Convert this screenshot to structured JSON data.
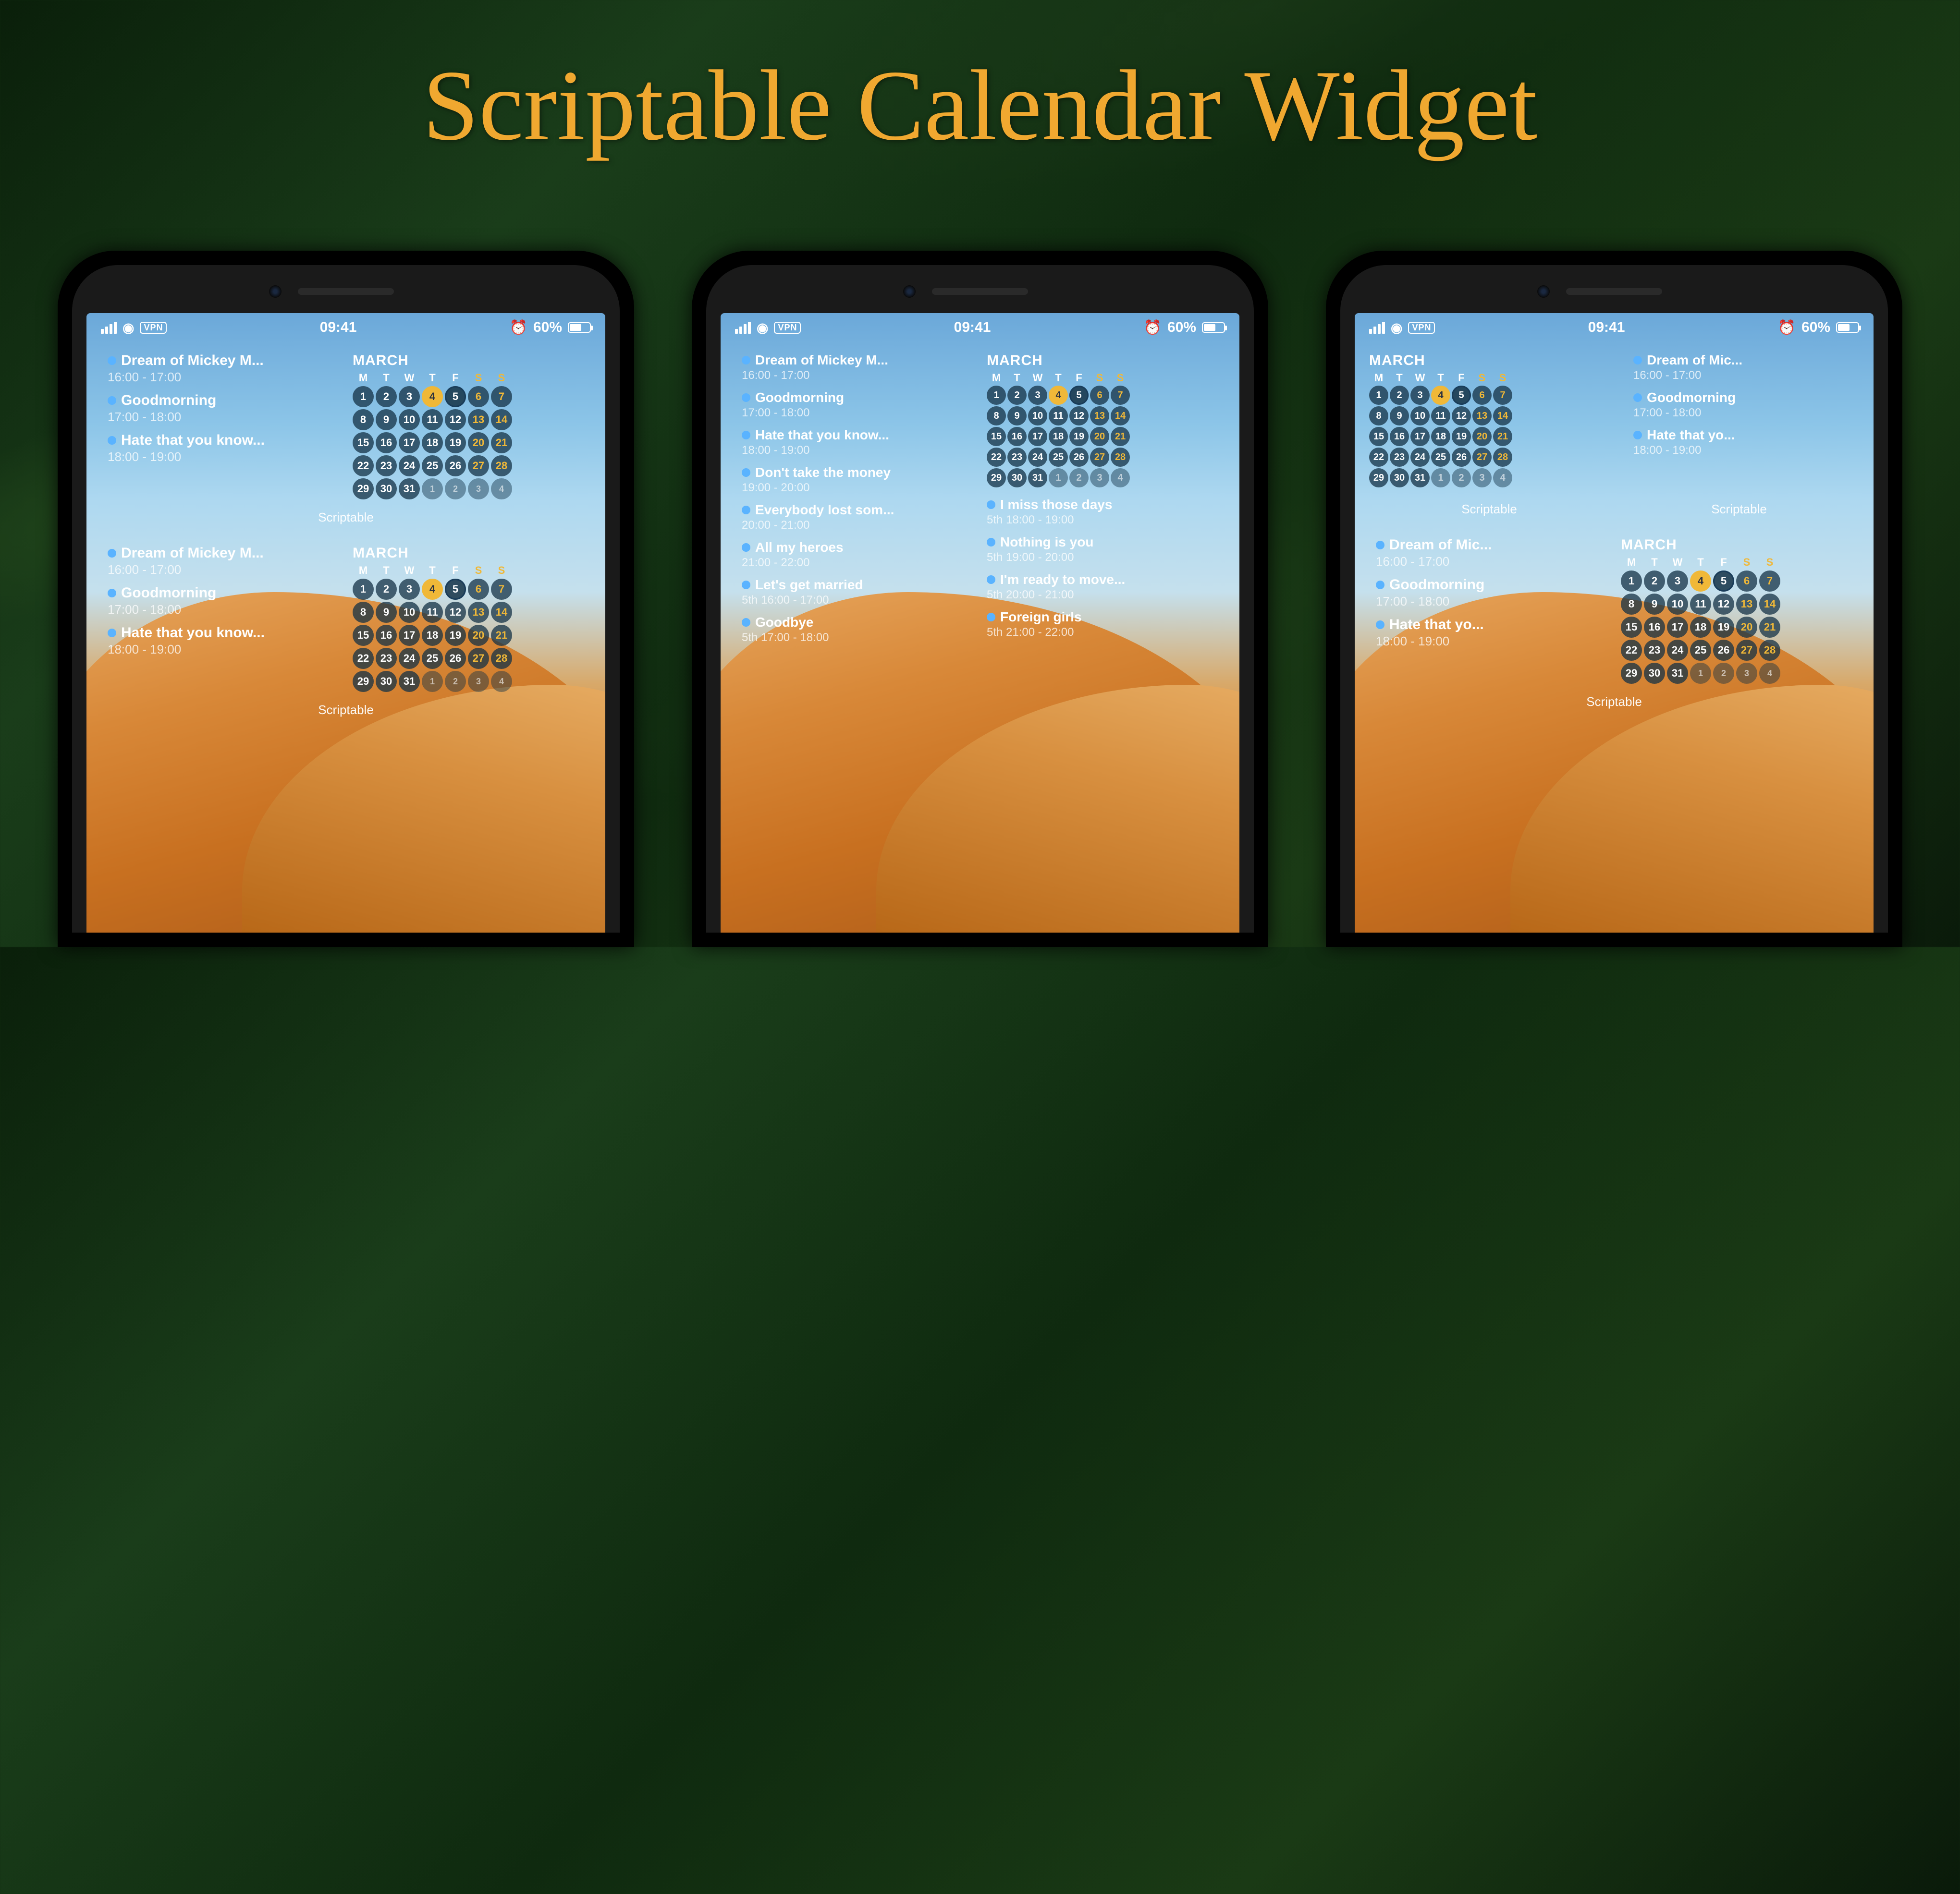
{
  "title": "Scriptable Calendar Widget",
  "status": {
    "time": "09:41",
    "vpn": "VPN",
    "battery": "60%"
  },
  "app_label": "Scriptable",
  "calendar": {
    "month": "MARCH",
    "weekdays": [
      "M",
      "T",
      "W",
      "T",
      "F",
      "S",
      "S"
    ],
    "today": 4,
    "weeks": [
      [
        {
          "d": 1
        },
        {
          "d": 2
        },
        {
          "d": 3
        },
        {
          "d": 4,
          "t": true
        },
        {
          "d": 5,
          "e": true
        },
        {
          "d": 6,
          "w": true
        },
        {
          "d": 7,
          "w": true
        }
      ],
      [
        {
          "d": 8
        },
        {
          "d": 9
        },
        {
          "d": 10
        },
        {
          "d": 11
        },
        {
          "d": 12
        },
        {
          "d": 13,
          "w": true
        },
        {
          "d": 14,
          "w": true
        }
      ],
      [
        {
          "d": 15
        },
        {
          "d": 16
        },
        {
          "d": 17
        },
        {
          "d": 18
        },
        {
          "d": 19
        },
        {
          "d": 20,
          "w": true
        },
        {
          "d": 21,
          "w": true
        }
      ],
      [
        {
          "d": 22
        },
        {
          "d": 23
        },
        {
          "d": 24
        },
        {
          "d": 25
        },
        {
          "d": 26
        },
        {
          "d": 27,
          "w": true
        },
        {
          "d": 28,
          "w": true
        }
      ],
      [
        {
          "d": 29
        },
        {
          "d": 30
        },
        {
          "d": 31
        },
        {
          "d": 1,
          "o": true
        },
        {
          "d": 2,
          "o": true
        },
        {
          "d": 3,
          "o": true,
          "w": true
        },
        {
          "d": 4,
          "o": true,
          "w": true
        }
      ]
    ]
  },
  "events_short": [
    {
      "title": "Dream of Mickey M...",
      "time": "16:00 - 17:00"
    },
    {
      "title": "Goodmorning",
      "time": "17:00 - 18:00"
    },
    {
      "title": "Hate that you know...",
      "time": "18:00 - 19:00"
    }
  ],
  "events_short_narrow": [
    {
      "title": "Dream of Mic...",
      "time": "16:00 - 17:00"
    },
    {
      "title": "Goodmorning",
      "time": "17:00 - 18:00"
    },
    {
      "title": "Hate that yo...",
      "time": "18:00 - 19:00"
    }
  ],
  "large_left_events": [
    {
      "title": "Dream of Mickey M...",
      "time": "16:00 - 17:00"
    },
    {
      "title": "Goodmorning",
      "time": "17:00 - 18:00"
    },
    {
      "title": "Hate that you know...",
      "time": "18:00 - 19:00"
    },
    {
      "title": "Don't take the money",
      "time": "19:00 - 20:00"
    },
    {
      "title": "Everybody lost som...",
      "time": "20:00 - 21:00"
    },
    {
      "title": "All my heroes",
      "time": "21:00 - 22:00"
    },
    {
      "title": "Let's get married",
      "time": "5th 16:00 - 17:00"
    },
    {
      "title": "Goodbye",
      "time": "5th 17:00 - 18:00"
    }
  ],
  "large_right_events": [
    {
      "title": "I miss those days",
      "time": "5th 18:00 - 19:00"
    },
    {
      "title": "Nothing is you",
      "time": "5th 19:00 - 20:00"
    },
    {
      "title": "I'm ready to move...",
      "time": "5th 20:00 - 21:00"
    },
    {
      "title": "Foreign girls",
      "time": "5th 21:00 - 22:00"
    }
  ]
}
